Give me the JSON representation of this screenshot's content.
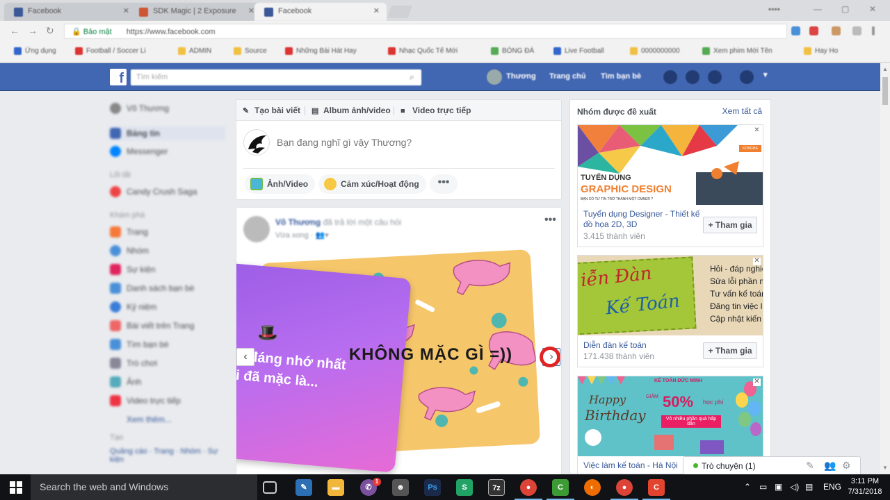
{
  "browser": {
    "tabs": [
      {
        "label": "Facebook"
      },
      {
        "label": "SDK Magic | 2 Exposure"
      },
      {
        "label": "Facebook"
      }
    ],
    "secure_label": "Bảo mật",
    "url": "https://www.facebook.com",
    "bookmarks": [
      "Ứng dụng",
      "Football / Soccer Li",
      "ADMIN",
      "Source",
      "Những Bài Hát Hay",
      "Nhạc Quốc Tế Mới",
      "BÓNG ĐÁ",
      "Live Football",
      "0000000000",
      "Xem phim Mới Tên",
      "Hay Ho"
    ]
  },
  "fb_header": {
    "logo": "f",
    "search_placeholder": "Tìm kiếm",
    "user": "Thương",
    "home": "Trang chủ",
    "find_friends": "Tìm bạn bè"
  },
  "left_nav": {
    "profile": "Võ Thương",
    "items": [
      "Bảng tin",
      "Messenger"
    ],
    "shortcuts_title": "Lối tắt",
    "shortcuts": [
      "Candy Crush Saga"
    ],
    "explore_title": "Khám phá",
    "explore": [
      "Trang",
      "Nhóm",
      "Sự kiện",
      "Danh sách bạn bè",
      "Kỷ niệm",
      "Bài viết trên Trang",
      "Tìm bạn bè",
      "Trò chơi",
      "Ảnh",
      "Video trực tiếp"
    ],
    "see_more": "Xem thêm...",
    "create_title": "Tạo",
    "create_links": "Quảng cáo · Trang · Nhóm · Sự kiện"
  },
  "composer": {
    "tab_create": "Tạo bài viết",
    "tab_album": "Album ảnh/video",
    "tab_live": "Video trực tiếp",
    "placeholder": "Bạn đang nghĩ gì vậy Thương?",
    "photo_video": "Ảnh/Video",
    "feeling": "Cảm xúc/Hoạt động",
    "more": "•••"
  },
  "post": {
    "author": "Võ Thương",
    "author_suffix": "đã trả lời một câu hỏi",
    "time": "Vừa xong",
    "more": "•••",
    "card_main": "KHÔNG MẶC GÌ =))",
    "card_side_line1": "c đáng nhớ nhất",
    "card_side_line2": "i đã mặc là...",
    "prev": "‹",
    "next": "›"
  },
  "suggested_groups": {
    "title": "Nhóm được đề xuất",
    "see_all": "Xem tất cả",
    "join_label": "+ Tham gia",
    "groups": [
      {
        "name": "Tuyển dụng Designer - Thiết kế đồ họa 2D, 3D",
        "members": "3.415 thành viên",
        "img_line1": "TUYỂN DỤNG",
        "img_line2": "GRAPHIC DESIGN",
        "img_line3": "BẠN CÓ TƯ TIN TRỞ THÀNH MỘT CMNER ?",
        "img_badge": "KONGHA"
      },
      {
        "name": "Diễn đàn kế toán",
        "members": "171.438 thành viên",
        "img_line1": "iễn Đàn",
        "img_line2": "Kế Toán",
        "img_list": [
          "Hỏi - đáp nghiệ",
          "Sửa lỗi phần mề",
          "Tư vấn kế toán",
          "Đăng tin việc l",
          "Cập nhật kiến t"
        ]
      },
      {
        "name": "Việc làm kế toán - Hà Nội",
        "img_top": "KẾ TOÁN ĐỨC MINH",
        "img_happy": "Happy",
        "img_birthday": "Birthday",
        "img_discount_label": "GIẢM",
        "img_discount": "50%",
        "img_discount_suffix": "học phí",
        "img_gift": "Vô nhiều phần quà hấp dẫn"
      }
    ]
  },
  "chat": {
    "label": "Trò chuyện (1)"
  },
  "taskbar": {
    "search_placeholder": "Search the web and Windows",
    "apps": [
      {
        "name": "task-view",
        "label": "▭",
        "color": "#101216"
      },
      {
        "name": "app-blue",
        "label": "✎",
        "color": "#2c6fb5"
      },
      {
        "name": "file-explorer",
        "label": "▬",
        "color": "#f2b73a"
      },
      {
        "name": "viber",
        "label": "✆",
        "color": "#7b519d"
      },
      {
        "name": "app-mask",
        "label": "☻",
        "color": "#555555"
      },
      {
        "name": "photoshop",
        "label": "Ps",
        "color": "#1c2a4a"
      },
      {
        "name": "app-s",
        "label": "S",
        "color": "#21a366"
      },
      {
        "name": "7zip",
        "label": "7z",
        "color": "#333333"
      },
      {
        "name": "chrome-1",
        "label": "●",
        "color": "#db4437"
      },
      {
        "name": "camtasia",
        "label": "C",
        "color": "#3d9b35"
      },
      {
        "name": "app-orange",
        "label": "◐",
        "color": "#ef6c00"
      },
      {
        "name": "chrome-2",
        "label": "●",
        "color": "#db4437"
      },
      {
        "name": "app-red",
        "label": "C",
        "color": "#e2442f"
      }
    ],
    "lang": "ENG",
    "time": "3:11 PM",
    "date": "7/31/2018",
    "viber_badge": "1"
  }
}
